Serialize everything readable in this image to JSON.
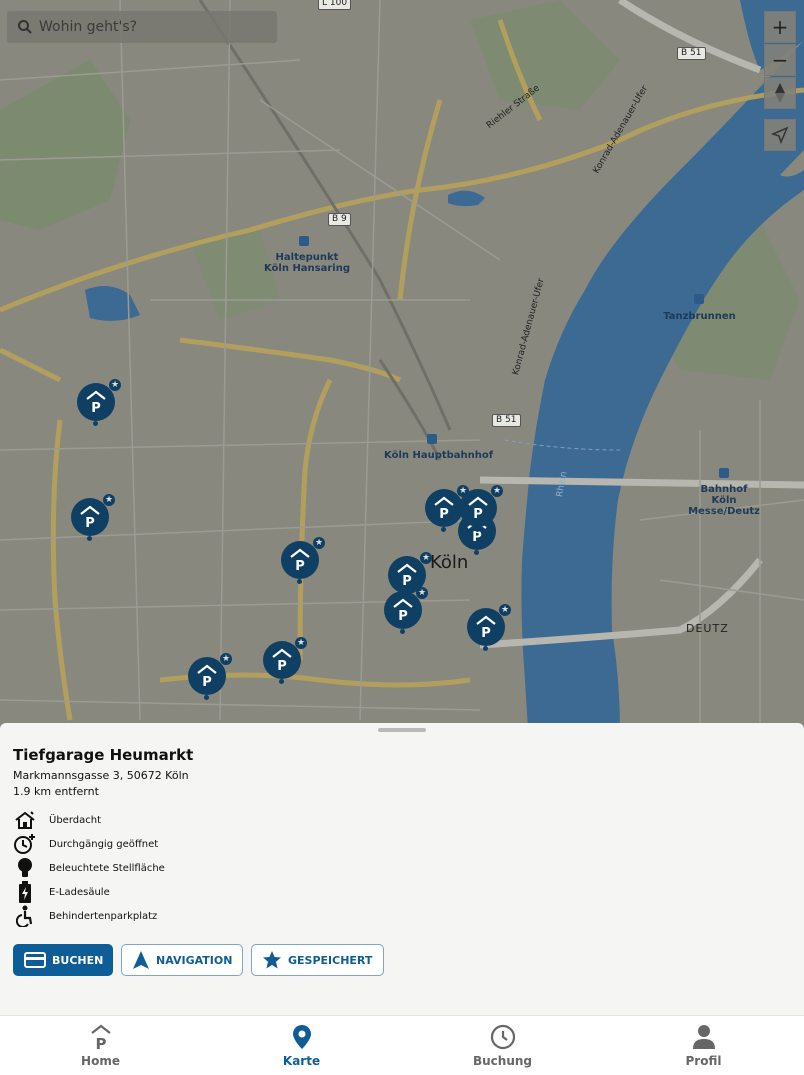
{
  "search": {
    "placeholder": "Wohin geht's?"
  },
  "map_controls": {
    "zoom_in": "+",
    "zoom_out": "−"
  },
  "map": {
    "road_shields": [
      "L 100",
      "B 51",
      "B 9",
      "B 51"
    ],
    "streets": [
      "Riehler Straße",
      "Konrad-Adenauer-Ufer",
      "Konrad-Adenauer-Ufer",
      "Rhein"
    ],
    "places": [
      "Haltepunkt Köln Hansaring",
      "Tanzbrunnen",
      "Köln Hauptbahnhof",
      "Bahnhof Köln Messe/Deutz"
    ],
    "city": "Köln",
    "district": "DEUTZ"
  },
  "detail": {
    "title": "Tiefgarage Heumarkt",
    "address": "Markmannsgasse 3, 50672 Köln",
    "distance": "1.9 km entfernt",
    "features": [
      {
        "icon": "covered-icon",
        "label": "Überdacht"
      },
      {
        "icon": "clock-24h-icon",
        "label": "Durchgängig geöffnet"
      },
      {
        "icon": "lightbulb-icon",
        "label": "Beleuchtete Stellfläche"
      },
      {
        "icon": "charging-icon",
        "label": "E-Ladesäule"
      },
      {
        "icon": "wheelchair-icon",
        "label": "Behindertenparkplatz"
      }
    ],
    "buttons": {
      "book": "BUCHEN",
      "navigation": "NAVIGATION",
      "saved": "GESPEICHERT"
    }
  },
  "bottom_nav": [
    {
      "label": "Home",
      "icon": "parking-home-icon"
    },
    {
      "label": "Karte",
      "icon": "map-pin-icon"
    },
    {
      "label": "Buchung",
      "icon": "clock-icon"
    },
    {
      "label": "Profil",
      "icon": "person-icon"
    }
  ],
  "colors": {
    "primary": "#0f5d96",
    "marker": "#0f3f63",
    "river": "#3d6a93"
  }
}
